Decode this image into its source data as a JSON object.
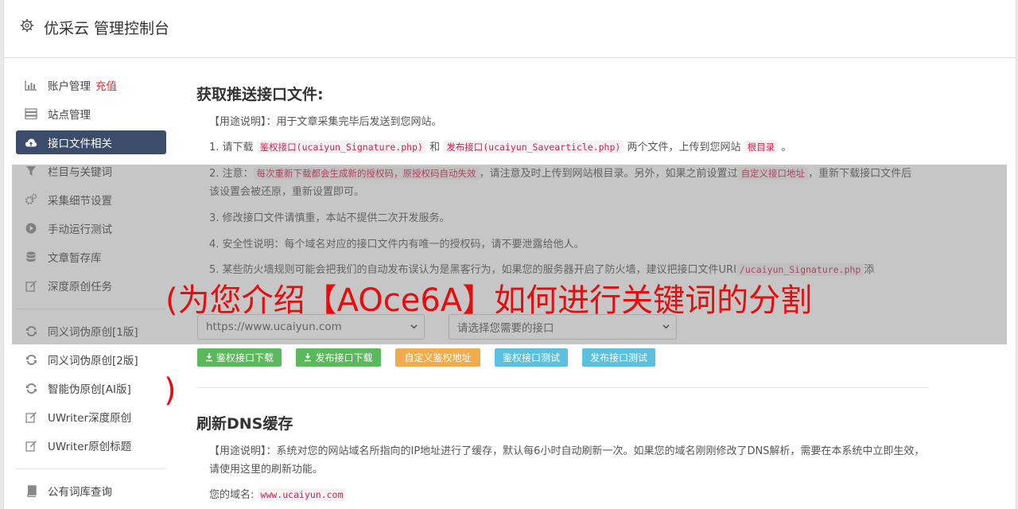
{
  "header": {
    "title": "优采云 管理控制台",
    "icon": "gear-icon"
  },
  "sidebar": {
    "items": [
      {
        "label": "账户管理",
        "tag": "充值",
        "icon": "bar-chart-icon",
        "active": false
      },
      {
        "label": "站点管理",
        "icon": "server-icon",
        "active": false
      },
      {
        "label": "接口文件相关",
        "icon": "cloud-upload-icon",
        "active": true
      },
      {
        "label": "栏目与关键词",
        "icon": "filter-icon",
        "active": false
      },
      {
        "label": "采集细节设置",
        "icon": "cogs-icon",
        "active": false
      },
      {
        "label": "手动运行测试",
        "icon": "play-circle-icon",
        "active": false
      },
      {
        "label": "文章暂存库",
        "icon": "database-icon",
        "active": false
      },
      {
        "label": "深度原创任务",
        "icon": "edit-icon",
        "active": false
      },
      {
        "label": "同义词伪原创[1版]",
        "icon": "refresh-icon",
        "active": false
      },
      {
        "label": "同义词伪原创[2版]",
        "icon": "refresh-icon",
        "active": false
      },
      {
        "label": "智能伪原创[AI版]",
        "icon": "refresh-icon",
        "active": false
      },
      {
        "label": "UWriter深度原创",
        "icon": "edit-icon",
        "active": false
      },
      {
        "label": "UWriter原创标题",
        "icon": "edit-icon",
        "active": false
      },
      {
        "label": "公有词库查询",
        "icon": "book-icon",
        "active": false
      }
    ]
  },
  "section1": {
    "title": "获取推送接口文件:",
    "usage": "【用途说明】：用于文章采集完毕后发送到您网站。",
    "step1_a": "1. 请下载",
    "step1_code1": "鉴权接口(ucaiyun_Signature.php)",
    "step1_b": "和",
    "step1_code2": "发布接口(ucaiyun_Savearticle.php)",
    "step1_c": "两个文件，上传到您网站",
    "step1_code3": "根目录",
    "step1_d": "。",
    "step2_a": "2. 注意：",
    "step2_code1": "每次重新下载都会生成新的授权码，原授权码自动失效",
    "step2_b": "，请注意及时上传到网站根目录。另外，如果之前设置过",
    "step2_code2": "自定义接口地址",
    "step2_c": "，重新下载接口文件后该设置会被还原，重新设置即可。",
    "step3": "3. 修改接口文件请慎重，本站不提供二次开发服务。",
    "step4": "4. 安全性说明：每个域名对应的接口文件内有唯一的授权码，请不要泄露给他人。",
    "step5_a": "5. 某些防火墙规则可能会把我们的自动发布误认为是黑客行为，如果您的服务器开启了防火墙，建议把接口文件URI",
    "step5_code": "/ucaiyun_Signature.php",
    "step5_b": "添",
    "select_site": "https://www.ucaiyun.com",
    "select_api": "请选择您需要的接口",
    "buttons": {
      "download_auth": "鉴权接口下载",
      "download_publish": "发布接口下载",
      "custom_auth": "自定义鉴权地址",
      "test_auth": "鉴权接口测试",
      "test_publish": "发布接口测试"
    }
  },
  "overlay": {
    "banner": "(为您介绍【AOce6A】如何进行关键词的分割",
    "banner_end": ")"
  },
  "section2": {
    "title": "刷新DNS缓存",
    "usage": "【用途说明】：系统对您的网站域名所指向的IP地址进行了缓存，默认每6小时自动刷新一次。如果您的域名刚刚修改了DNS解析，需要在本系统中立即生效，请使用这里的刷新功能。",
    "domain_label": "您的域名:",
    "domain_value": "www.ucaiyun.com"
  },
  "colors": {
    "active_nav": "#3c4d6b",
    "green": "#5cb85c",
    "orange": "#f0ad4e",
    "blue": "#5bc0de",
    "banner": "#e01010"
  }
}
